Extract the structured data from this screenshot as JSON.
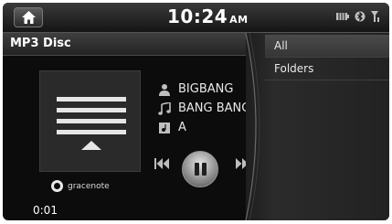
{
  "status": {
    "time": "10:24",
    "ampm": "AM",
    "icons": [
      "battery-icon",
      "bluetooth-icon",
      "signal-icon"
    ]
  },
  "header": {
    "title": "MP3 Disc"
  },
  "track": {
    "artist": "BIGBANG",
    "song": "BANG BANG",
    "album": "A",
    "elapsed": "0:01"
  },
  "branding": {
    "gracenote": "gracenote"
  },
  "menu": {
    "items": [
      {
        "label": "All",
        "selected": true
      },
      {
        "label": "Folders",
        "selected": false
      }
    ]
  },
  "colors": {
    "background": "#0c0c0c",
    "text": "#ffffff",
    "selected_item": "#404040"
  }
}
